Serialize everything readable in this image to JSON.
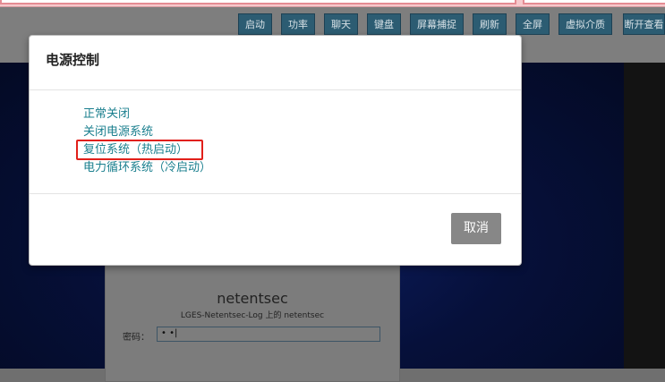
{
  "toolbar": {
    "buttons": [
      "启动",
      "功率",
      "聊天",
      "键盘",
      "屏幕捕捉",
      "刷新",
      "全屏",
      "虚拟介质",
      "断开查看"
    ]
  },
  "modal": {
    "title": "电源控制",
    "options": [
      "正常关闭",
      "关闭电源系统",
      "复位系统（热启动）",
      "电力循环系统（冷启动）"
    ],
    "cancel_label": "取消",
    "highlighted_option": "复位系统（热启动）",
    "highlight_color": "#e1201a",
    "link_color": "#1a7f8e"
  },
  "login": {
    "hostname": "netentsec",
    "subtitle": "LGES-Netentsec-Log 上的  netentsec",
    "password_label": "密码：",
    "password_value": "• •|"
  }
}
